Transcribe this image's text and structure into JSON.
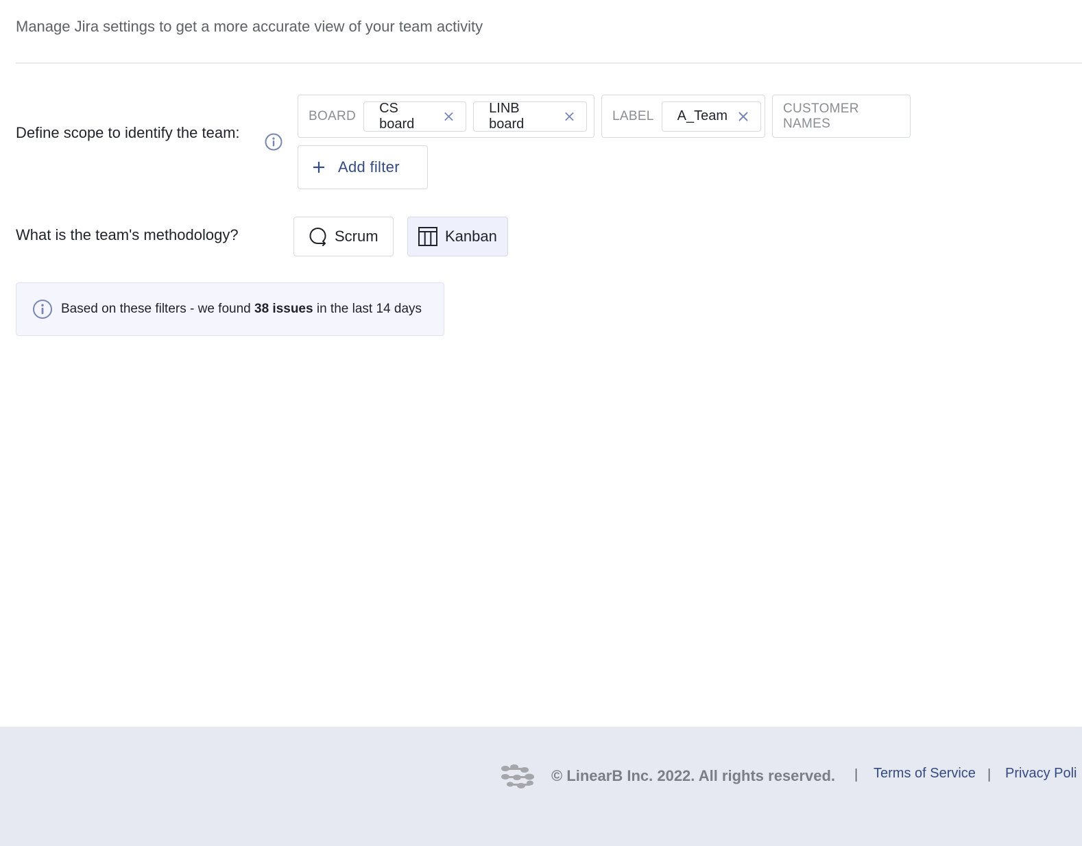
{
  "header": {
    "subtitle": "Manage Jira settings to get a more accurate view of your team activity"
  },
  "scope": {
    "label": "Define scope to identify the team:",
    "filters": [
      {
        "type": "BOARD",
        "values": [
          "CS board",
          "LINB board"
        ]
      },
      {
        "type": "LABEL",
        "values": [
          "A_Team"
        ]
      },
      {
        "type": "CUSTOMER NAMES",
        "values": []
      }
    ],
    "add_filter_label": "Add filter"
  },
  "methodology": {
    "label": "What is the team's methodology?",
    "options": [
      {
        "label": "Scrum",
        "icon": "scrum-loop-icon",
        "selected": false
      },
      {
        "label": "Kanban",
        "icon": "kanban-board-icon",
        "selected": true
      }
    ]
  },
  "notice": {
    "prefix": "Based on these filters - we found",
    "count": "38 issues",
    "suffix": "in the last 14 days"
  },
  "footer": {
    "copyright": "© LinearB Inc. 2022. All rights reserved.",
    "separator": "|",
    "links": [
      "Terms of Service",
      "Privacy Poli"
    ]
  },
  "colors": {
    "accent": "#334b80",
    "icon": "#7886b3",
    "footer_bg": "#e6e9f2",
    "selected_bg": "#eef0fb"
  }
}
